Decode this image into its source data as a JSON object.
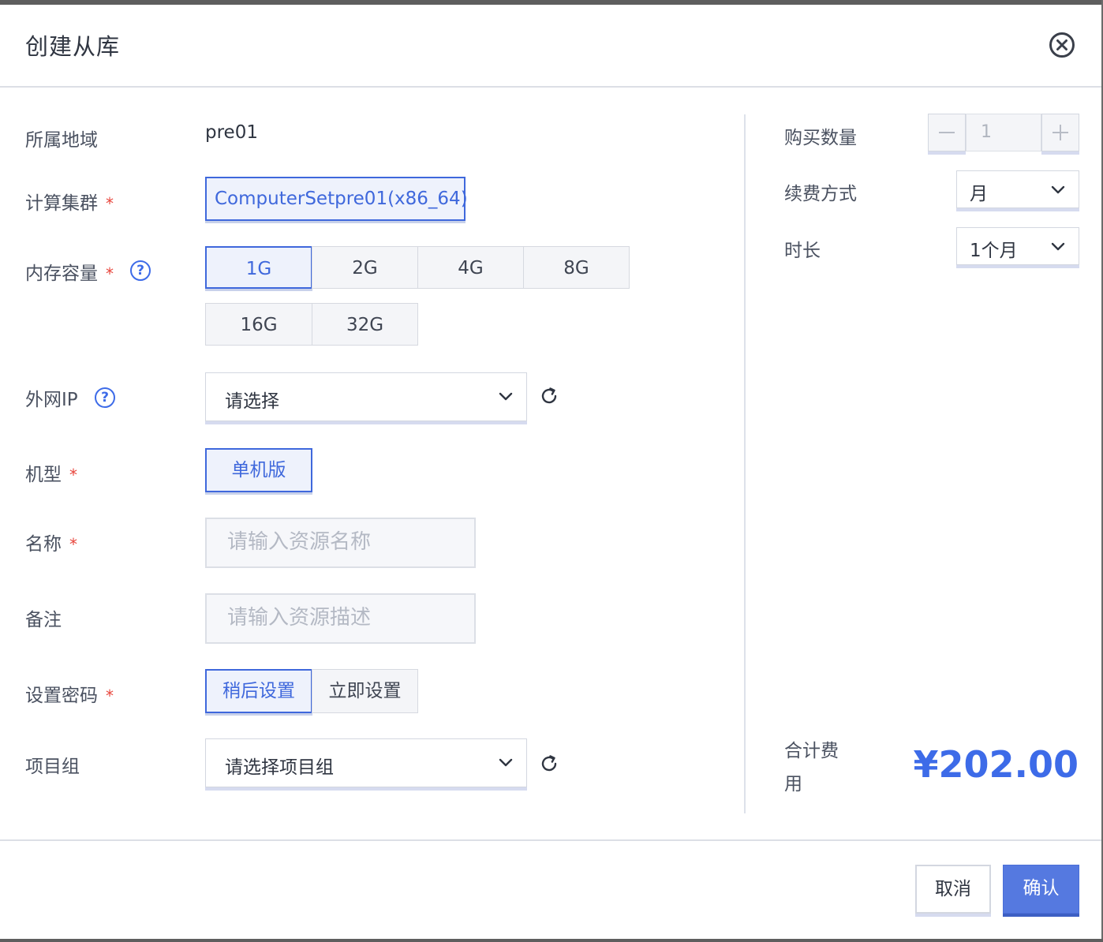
{
  "dialog": {
    "title": "创建从库"
  },
  "form": {
    "region": {
      "label": "所属地域",
      "value": "pre01"
    },
    "cluster": {
      "label": "计算集群",
      "required_mark": "*",
      "value": "ComputerSetpre01(x86_64)"
    },
    "memory": {
      "label": "内存容量",
      "required_mark": "*",
      "help": "?",
      "options": [
        "1G",
        "2G",
        "4G",
        "8G",
        "16G",
        "32G"
      ],
      "selected": "1G"
    },
    "public_ip": {
      "label": "外网IP",
      "help": "?",
      "value": "请选择"
    },
    "model": {
      "label": "机型",
      "required_mark": "*",
      "options": [
        "单机版"
      ],
      "selected": "单机版"
    },
    "name": {
      "label": "名称",
      "required_mark": "*",
      "placeholder": "请输入资源名称"
    },
    "remark": {
      "label": "备注",
      "placeholder": "请输入资源描述"
    },
    "password": {
      "label": "设置密码",
      "required_mark": "*",
      "options": [
        "稍后设置",
        "立即设置"
      ],
      "selected": "稍后设置"
    },
    "project_group": {
      "label": "项目组",
      "value": "请选择项目组"
    }
  },
  "purchase": {
    "quantity": {
      "label": "购买数量",
      "value": "1",
      "minus": "−",
      "plus": "+"
    },
    "billing": {
      "label": "续费方式",
      "value": "月"
    },
    "duration": {
      "label": "时长",
      "value": "1个月"
    },
    "total": {
      "label_line1": "合计费",
      "label_line2": "用",
      "price": "¥202.00"
    }
  },
  "footer": {
    "cancel": "取消",
    "confirm": "确认"
  },
  "colors": {
    "accent": "#3d6be8",
    "required": "#e8453c",
    "confirm_bg": "#5579e0"
  },
  "icons": [
    "close-icon",
    "help-icon",
    "chevron-down-icon",
    "refresh-icon",
    "minus-icon",
    "plus-icon"
  ]
}
